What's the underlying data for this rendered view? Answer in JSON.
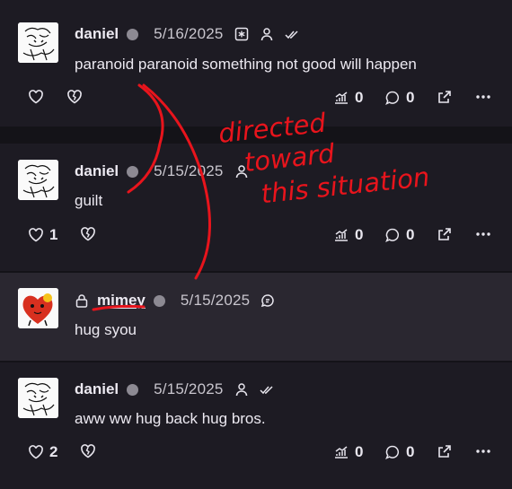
{
  "posts": [
    {
      "author": "daniel",
      "date": "5/16/2025",
      "text": "paranoid paranoid something not good will happen",
      "likes": "",
      "views": "0",
      "replies": "0"
    },
    {
      "author": "daniel",
      "date": "5/15/2025",
      "text": "guilt",
      "likes": "1",
      "views": "0",
      "replies": "0"
    },
    {
      "author": "mimey",
      "date": "5/15/2025",
      "text": "hug syou"
    },
    {
      "author": "daniel",
      "date": "5/15/2025",
      "text": "aww ww hug back hug bros.",
      "likes": "2",
      "views": "0",
      "replies": "0"
    }
  ],
  "annotation": {
    "line1": "directed",
    "line2": "toward",
    "line3": "this situation",
    "color": "#e8141c"
  },
  "colors": {
    "background": "#141318",
    "card": "#1d1b23",
    "highlight_card": "#2a2730",
    "status_dot": "#8d8a93"
  }
}
